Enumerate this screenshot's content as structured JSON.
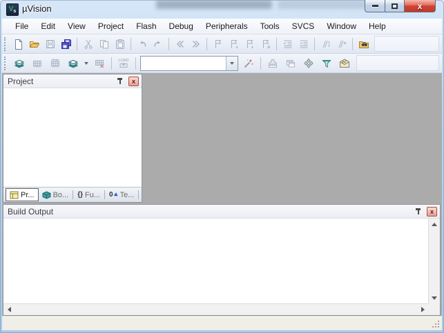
{
  "window": {
    "title": "µVision"
  },
  "menu": {
    "items": [
      "File",
      "Edit",
      "View",
      "Project",
      "Flash",
      "Debug",
      "Peripherals",
      "Tools",
      "SVCS",
      "Window",
      "Help"
    ]
  },
  "toolbar": {
    "load_label": "LOAD",
    "target_select_value": ""
  },
  "project_panel": {
    "title": "Project",
    "tabs": [
      {
        "label": "Pr..."
      },
      {
        "label": "Bo..."
      },
      {
        "label": "Fu...",
        "glyph": "{}"
      },
      {
        "label": "Te...",
        "glyph": "0"
      }
    ]
  },
  "build_output": {
    "title": "Build Output",
    "content": ""
  },
  "status_bar": {
    "text": ""
  },
  "glyphs": {
    "panel_close": "x",
    "window_close": "x"
  },
  "colors": {
    "titlebar": "#bcd6ef",
    "workspace_background": "#ababab",
    "toolbar_background": "#e9eef6",
    "close_button_red": "#cf4334",
    "folder_yellow": "#f6c45c",
    "save_all_blue": "#5353cd",
    "build_teal": "#2f9596"
  }
}
